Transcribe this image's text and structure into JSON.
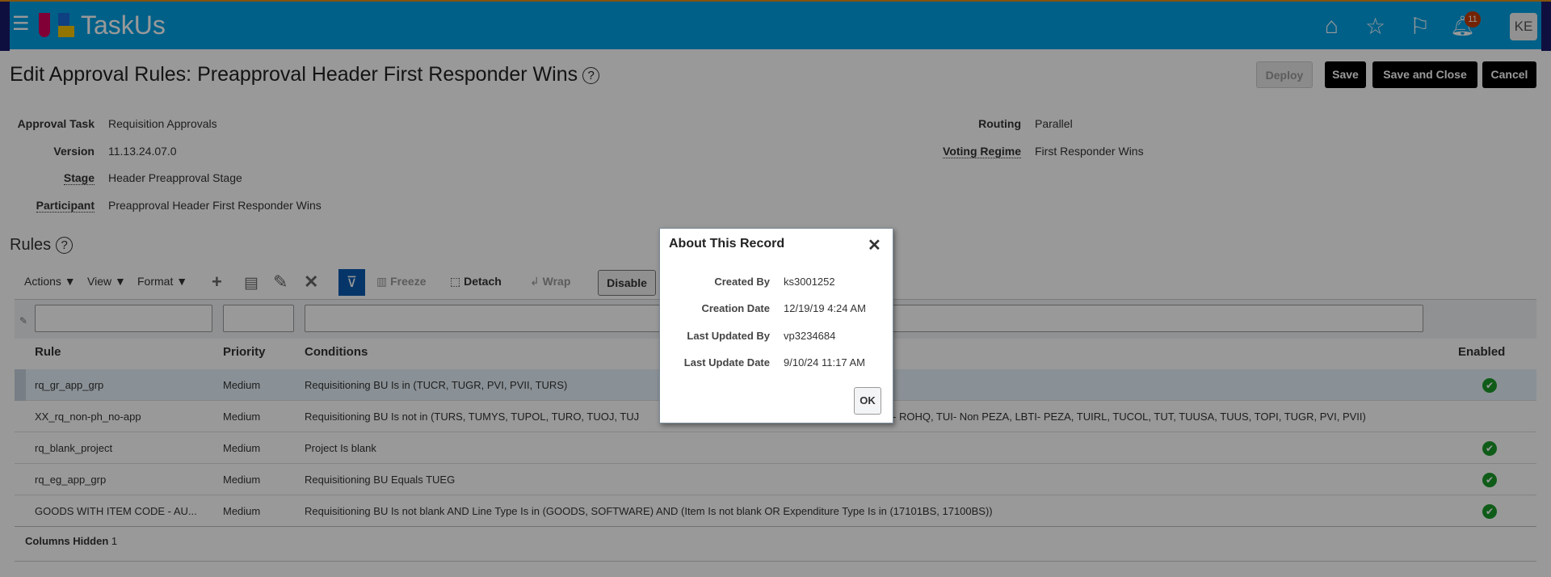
{
  "header": {
    "brand": "TaskUs",
    "notification_count": "11",
    "avatar_initials": "KE"
  },
  "page": {
    "title": "Edit Approval Rules: Preapproval Header First Responder Wins",
    "buttons": {
      "deploy": "Deploy",
      "save": "Save",
      "save_close": "Save and Close",
      "cancel": "Cancel"
    }
  },
  "fields": {
    "approval_task": {
      "label": "Approval Task",
      "value": "Requisition Approvals"
    },
    "version": {
      "label": "Version",
      "value": "11.13.24.07.0"
    },
    "stage": {
      "label": "Stage",
      "value": "Header Preapproval Stage"
    },
    "participant": {
      "label": "Participant",
      "value": "Preapproval Header First Responder Wins"
    },
    "routing": {
      "label": "Routing",
      "value": "Parallel"
    },
    "voting_regime": {
      "label": "Voting Regime",
      "value": "First Responder Wins"
    }
  },
  "rules": {
    "heading": "Rules",
    "toolbar": {
      "actions": "Actions",
      "view": "View",
      "format": "Format",
      "freeze": "Freeze",
      "detach": "Detach",
      "wrap": "Wrap",
      "disable": "Disable"
    },
    "columns": {
      "rule": "Rule",
      "priority": "Priority",
      "conditions": "Conditions",
      "enabled": "Enabled"
    },
    "rows": [
      {
        "rule": "rq_gr_app_grp",
        "priority": "Medium",
        "conditions": "Requisitioning BU Is in (TUCR, TUGR, PVI, PVII, TURS)",
        "enabled": true
      },
      {
        "rule": "XX_rq_non-ph_no-app",
        "priority": "Medium",
        "conditions": "Requisitioning BU Is not in (TURS, TUMYS, TUPOL, TURO, TUOJ, TUJ",
        "conditions_tail": "- ROHQ, TUI- Non PEZA, LBTI- PEZA, TUIRL, TUCOL, TUT, TUUSA, TUUS, TOPI, TUGR, PVI, PVII)",
        "enabled": false
      },
      {
        "rule": "rq_blank_project",
        "priority": "Medium",
        "conditions": "Project Is blank",
        "enabled": true
      },
      {
        "rule": "rq_eg_app_grp",
        "priority": "Medium",
        "conditions": "Requisitioning BU Equals TUEG",
        "enabled": true
      },
      {
        "rule": "GOODS WITH ITEM CODE - AU...",
        "priority": "Medium",
        "conditions": "Requisitioning BU Is not blank AND Line Type Is in (GOODS, SOFTWARE) AND (Item Is not blank OR Expenditure Type Is in (17101BS, 17100BS))",
        "enabled": true
      }
    ],
    "columns_hidden_label": "Columns Hidden",
    "columns_hidden_count": "1"
  },
  "dialog": {
    "title": "About This Record",
    "created_by": {
      "label": "Created By",
      "value": "ks3001252"
    },
    "creation_date": {
      "label": "Creation Date",
      "value": "12/19/19 4:24 AM"
    },
    "last_updated_by": {
      "label": "Last Updated By",
      "value": "vp3234684"
    },
    "last_update_date": {
      "label": "Last Update Date",
      "value": "9/10/24 11:17 AM"
    },
    "ok": "OK"
  }
}
